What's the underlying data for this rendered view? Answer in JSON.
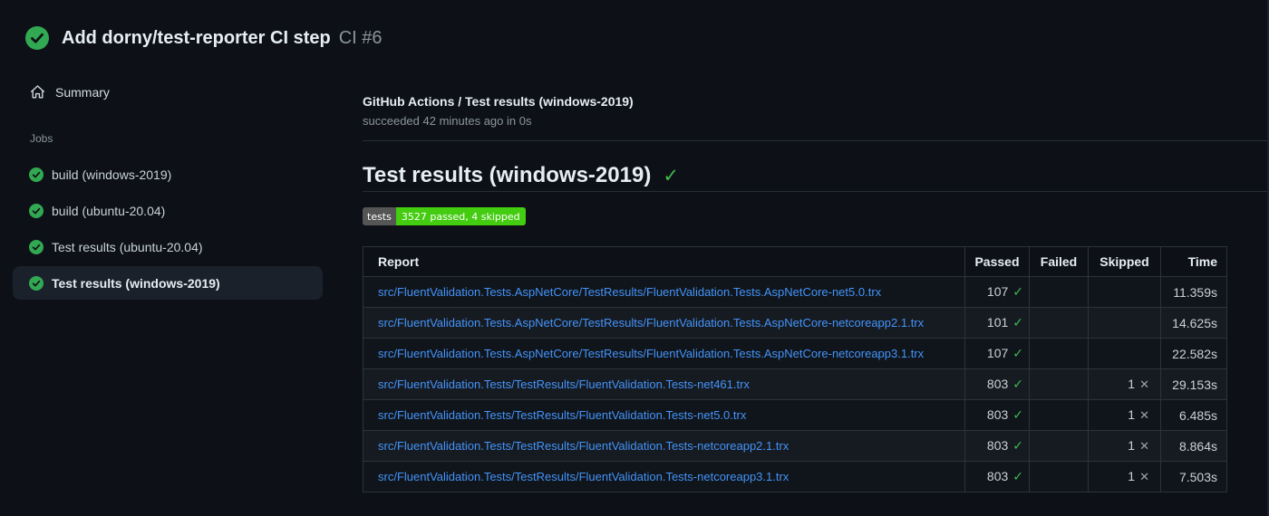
{
  "colors": {
    "background": "#0d1117",
    "accent_green": "#3fb950",
    "circle_green": "#32a852",
    "link_blue": "#4493f8",
    "muted_text": "#8b949e",
    "badge_label_bg": "#555555",
    "badge_value_bg": "#44cc11",
    "table_border": "#2d333b",
    "row_alt_bg": "#161b22",
    "selected_item_bg": "#1b212b"
  },
  "header": {
    "title": "Add dorny/test-reporter CI step",
    "run_label": "CI #6",
    "status_icon": "check-circle-icon"
  },
  "sidebar": {
    "summary_label": "Summary",
    "summary_icon": "home-icon",
    "jobs_heading": "Jobs",
    "jobs": [
      {
        "label": "build (windows-2019)",
        "status_icon": "check-circle-icon",
        "selected": false
      },
      {
        "label": "build (ubuntu-20.04)",
        "status_icon": "check-circle-icon",
        "selected": false
      },
      {
        "label": "Test results (ubuntu-20.04)",
        "status_icon": "check-circle-icon",
        "selected": false
      },
      {
        "label": "Test results (windows-2019)",
        "status_icon": "check-circle-icon",
        "selected": true
      }
    ]
  },
  "main": {
    "check_name": "GitHub Actions / Test results (windows-2019)",
    "check_status": "succeeded 42 minutes ago in 0s",
    "section_title": "Test results (windows-2019)",
    "section_check_glyph": "✓",
    "badge": {
      "label": "tests",
      "value": "3527 passed, 4 skipped"
    },
    "table": {
      "headers": {
        "report": "Report",
        "passed": "Passed",
        "failed": "Failed",
        "skipped": "Skipped",
        "time": "Time"
      },
      "rows": [
        {
          "report": "src/FluentValidation.Tests.AspNetCore/TestResults/FluentValidation.Tests.AspNetCore-net5.0.trx",
          "passed": "107",
          "passed_icon": "✓",
          "failed": "",
          "skipped": "",
          "skipped_icon": "",
          "time": "11.359s"
        },
        {
          "report": "src/FluentValidation.Tests.AspNetCore/TestResults/FluentValidation.Tests.AspNetCore-netcoreapp2.1.trx",
          "passed": "101",
          "passed_icon": "✓",
          "failed": "",
          "skipped": "",
          "skipped_icon": "",
          "time": "14.625s"
        },
        {
          "report": "src/FluentValidation.Tests.AspNetCore/TestResults/FluentValidation.Tests.AspNetCore-netcoreapp3.1.trx",
          "passed": "107",
          "passed_icon": "✓",
          "failed": "",
          "skipped": "",
          "skipped_icon": "",
          "time": "22.582s"
        },
        {
          "report": "src/FluentValidation.Tests/TestResults/FluentValidation.Tests-net461.trx",
          "passed": "803",
          "passed_icon": "✓",
          "failed": "",
          "skipped": "1",
          "skipped_icon": "✕",
          "time": "29.153s"
        },
        {
          "report": "src/FluentValidation.Tests/TestResults/FluentValidation.Tests-net5.0.trx",
          "passed": "803",
          "passed_icon": "✓",
          "failed": "",
          "skipped": "1",
          "skipped_icon": "✕",
          "time": "6.485s"
        },
        {
          "report": "src/FluentValidation.Tests/TestResults/FluentValidation.Tests-netcoreapp2.1.trx",
          "passed": "803",
          "passed_icon": "✓",
          "failed": "",
          "skipped": "1",
          "skipped_icon": "✕",
          "time": "8.864s"
        },
        {
          "report": "src/FluentValidation.Tests/TestResults/FluentValidation.Tests-netcoreapp3.1.trx",
          "passed": "803",
          "passed_icon": "✓",
          "failed": "",
          "skipped": "1",
          "skipped_icon": "✕",
          "time": "7.503s"
        }
      ]
    }
  }
}
